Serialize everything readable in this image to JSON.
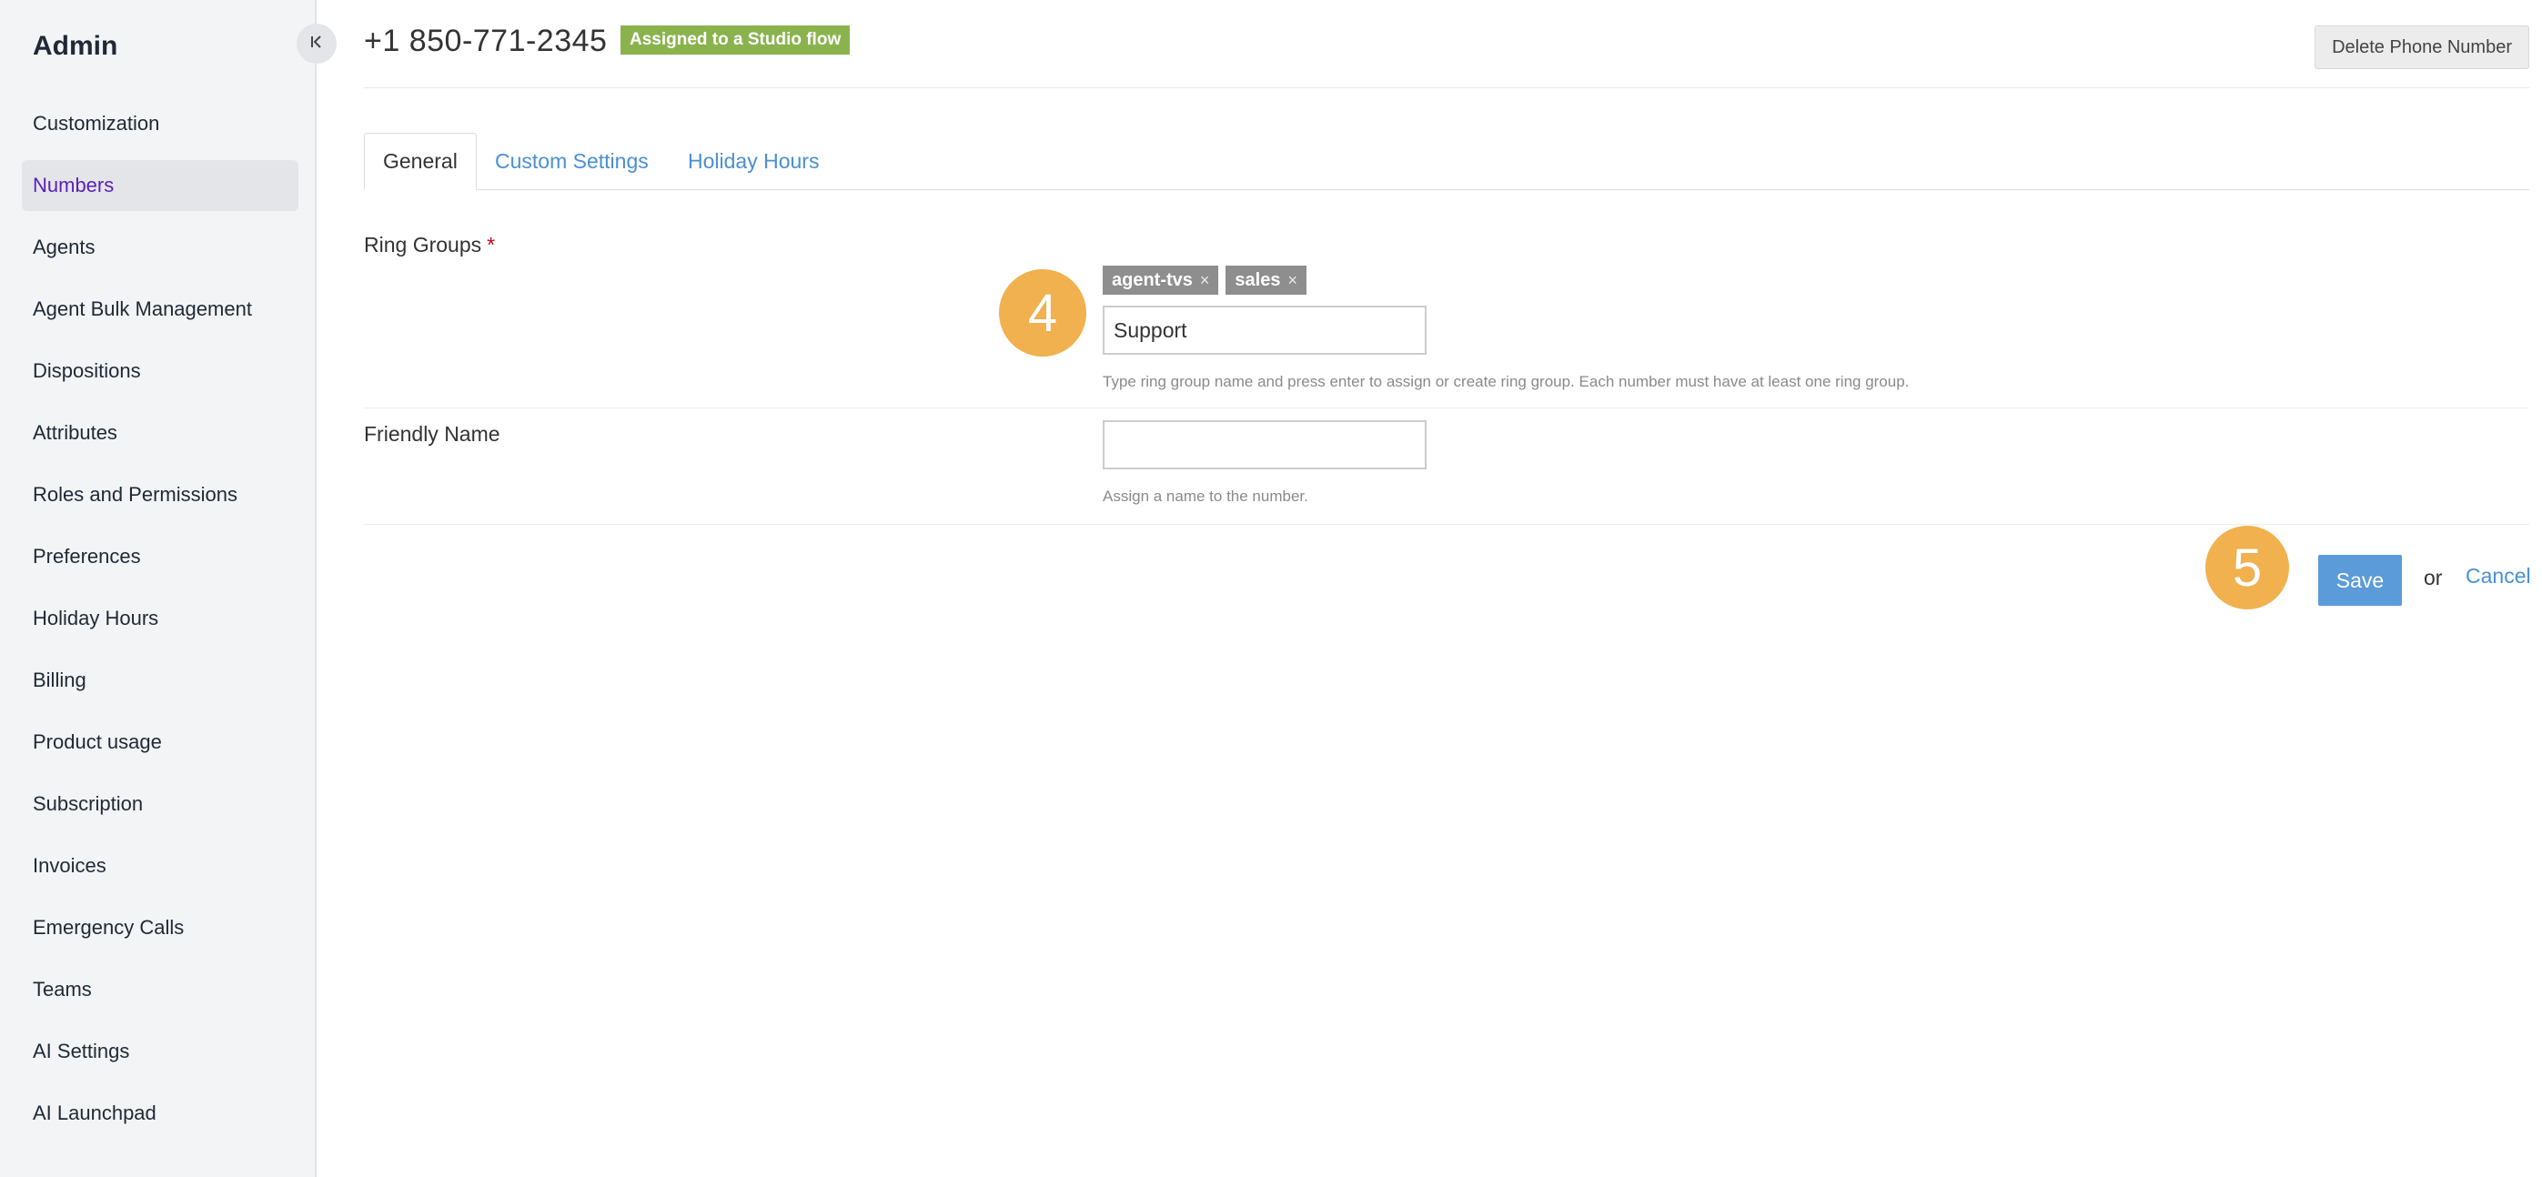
{
  "sidebar": {
    "title": "Admin",
    "collapse_icon": "collapse-left-icon",
    "items": [
      {
        "label": "Customization",
        "active": false
      },
      {
        "label": "Numbers",
        "active": true
      },
      {
        "label": "Agents",
        "active": false
      },
      {
        "label": "Agent Bulk Management",
        "active": false
      },
      {
        "label": "Dispositions",
        "active": false
      },
      {
        "label": "Attributes",
        "active": false
      },
      {
        "label": "Roles and Permissions",
        "active": false
      },
      {
        "label": "Preferences",
        "active": false
      },
      {
        "label": "Holiday Hours",
        "active": false
      },
      {
        "label": "Billing",
        "active": false
      },
      {
        "label": "Product usage",
        "active": false
      },
      {
        "label": "Subscription",
        "active": false
      },
      {
        "label": "Invoices",
        "active": false
      },
      {
        "label": "Emergency Calls",
        "active": false
      },
      {
        "label": "Teams",
        "active": false
      },
      {
        "label": "AI Settings",
        "active": false
      },
      {
        "label": "AI Launchpad",
        "active": false
      }
    ]
  },
  "header": {
    "phone_number": "+1 850-771-2345",
    "status_badge": "Assigned to a Studio flow",
    "delete_button": "Delete Phone Number"
  },
  "tabs": [
    {
      "label": "General",
      "active": true
    },
    {
      "label": "Custom Settings",
      "active": false
    },
    {
      "label": "Holiday Hours",
      "active": false
    }
  ],
  "form": {
    "ring_groups": {
      "label": "Ring Groups",
      "required_mark": "*",
      "tags": [
        {
          "label": "agent-tvs",
          "remove": "×"
        },
        {
          "label": "sales",
          "remove": "×"
        }
      ],
      "input_value": "Support",
      "help": "Type ring group name and press enter to assign or create ring group. Each number must have at least one ring group."
    },
    "friendly_name": {
      "label": "Friendly Name",
      "input_value": "",
      "help": "Assign a name to the number."
    }
  },
  "actions": {
    "save_label": "Save",
    "or_text": "or",
    "cancel_label": "Cancel"
  },
  "step_badges": [
    "4",
    "5"
  ],
  "colors": {
    "active_nav_text": "#5b21b6",
    "status_badge": "#8ab34e",
    "link": "#4a8fd4",
    "save_button": "#5b9bd9",
    "step_badge": "#f0b14e",
    "required": "#d0021b"
  }
}
